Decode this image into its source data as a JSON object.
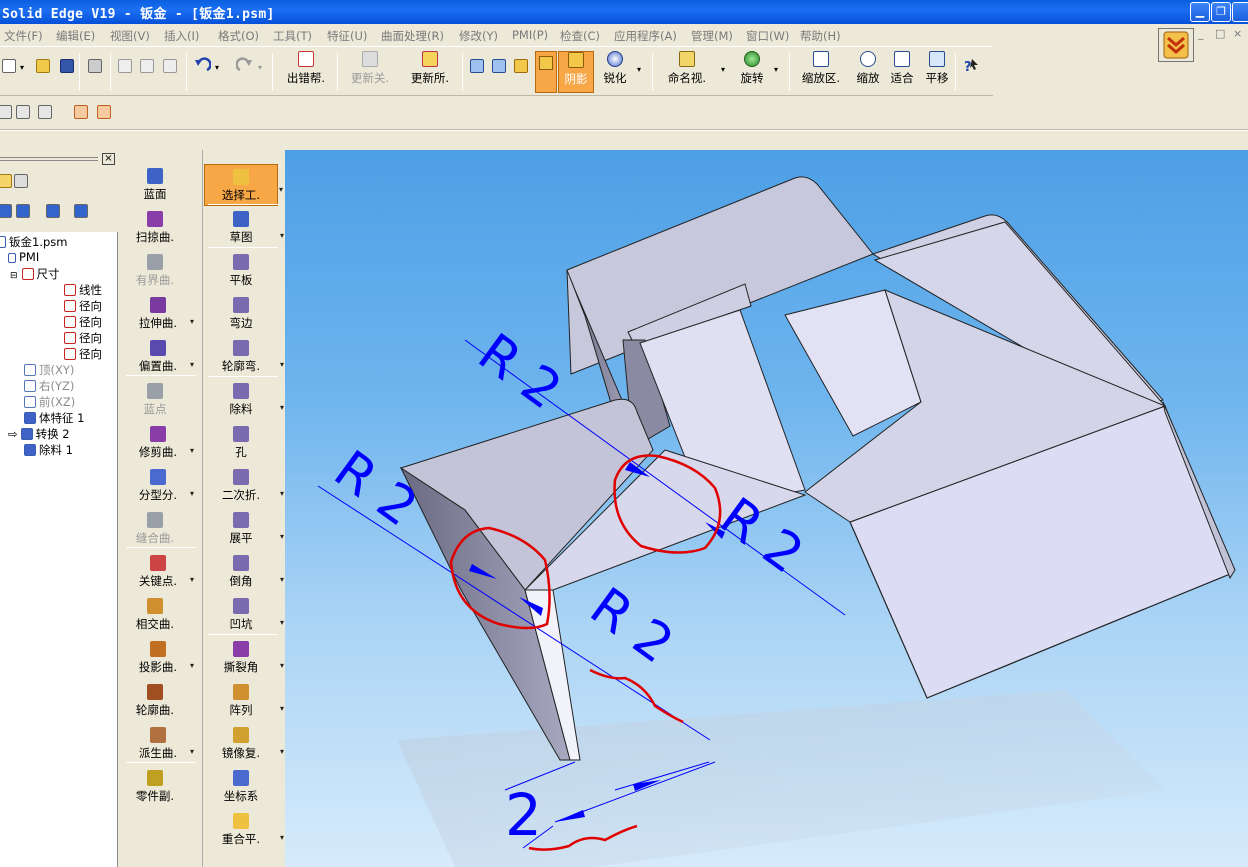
{
  "window": {
    "title": "Solid Edge V19 - 钣金 - [钣金1.psm]"
  },
  "menu": [
    "文件(F)",
    "编辑(E)",
    "视图(V)",
    "插入(I)",
    "格式(O)",
    "工具(T)",
    "特征(U)",
    "曲面处理(R)",
    "修改(Y)",
    "PMI(P)",
    "检查(C)",
    "应用程序(A)",
    "管理(M)",
    "窗口(W)",
    "帮助(H)"
  ],
  "toolbar": {
    "error_help": "出错帮.",
    "update_related": "更新关.",
    "update_all": "更新所.",
    "shading": "阴影",
    "sharpen": "锐化",
    "named_view": "命名视.",
    "rotate": "旋转",
    "zoom_area": "缩放区.",
    "zoom": "缩放",
    "fit": "适合",
    "pan": "平移"
  },
  "pathfinder": {
    "root": "钣金1.psm",
    "pmi": "PMI",
    "dimensions": "尺寸",
    "dim_items": [
      "线性",
      "径向",
      "径向",
      "径向",
      "径向"
    ],
    "planes": [
      "顶(XY)",
      "右(YZ)",
      "前(XZ)"
    ],
    "features": [
      "体特征 1",
      "转换 2",
      "除料 1"
    ]
  },
  "palette_left": [
    "蓝面",
    "扫掠曲.",
    "有界曲.",
    "拉伸曲.",
    "偏置曲.",
    "蓝点",
    "修剪曲.",
    "分型分.",
    "缝合曲.",
    "关键点.",
    "相交曲.",
    "投影曲.",
    "轮廓曲.",
    "派生曲.",
    "零件副."
  ],
  "palette_right": [
    "选择工.",
    "草图",
    "平板",
    "弯边",
    "轮廓弯.",
    "除料",
    "孔",
    "二次折.",
    "展平",
    "倒角",
    "凹坑",
    "撕裂角",
    "阵列",
    "镜像复.",
    "坐标系",
    "重合平."
  ],
  "dimensions": {
    "r1": "R 2",
    "r2": "R 2",
    "r3": "R 2",
    "r4": "R 2",
    "thickness": "2"
  },
  "colors": {
    "dimension": "#0000ff",
    "markup": "#e00000",
    "part_face": "#dcdcf0"
  }
}
